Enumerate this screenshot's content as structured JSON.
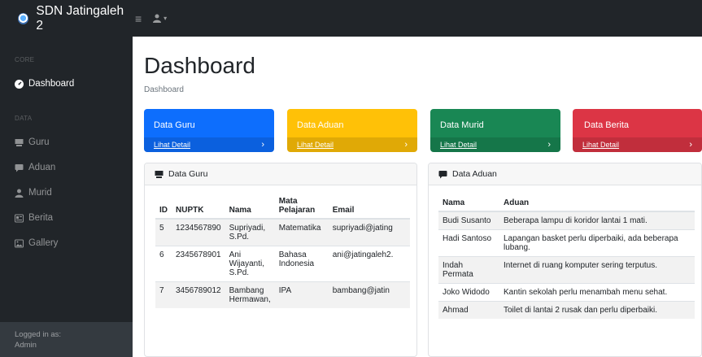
{
  "app": {
    "name": "SDN Jatingaleh 2"
  },
  "nav": {
    "toggle_icon": "≡",
    "user_icon": "♙"
  },
  "sidebar": {
    "core_heading": "CORE",
    "data_heading": "DATA",
    "items": [
      {
        "label": "Dashboard",
        "icon": "tachometer-icon"
      },
      {
        "label": "Guru",
        "icon": "chalkboard-teacher-icon"
      },
      {
        "label": "Aduan",
        "icon": "comment-icon"
      },
      {
        "label": "Murid",
        "icon": "user-icon"
      },
      {
        "label": "Berita",
        "icon": "newspaper-icon"
      },
      {
        "label": "Gallery",
        "icon": "image-icon"
      }
    ],
    "footer": {
      "line1": "Logged in as:",
      "line2": "Admin"
    }
  },
  "page": {
    "title": "Dashboard",
    "breadcrumb": "Dashboard"
  },
  "stat_cards": [
    {
      "title": "Data Guru",
      "link": "Lihat Detail",
      "color": "#0d6efd"
    },
    {
      "title": "Data Aduan",
      "link": "Lihat Detail",
      "color": "#ffc107"
    },
    {
      "title": "Data Murid",
      "link": "Lihat Detail",
      "color": "#198754"
    },
    {
      "title": "Data Berita",
      "link": "Lihat Detail",
      "color": "#dc3545"
    }
  ],
  "guru_panel": {
    "title": "Data Guru",
    "columns": [
      "ID",
      "NUPTK",
      "Nama",
      "Mata Pelajaran",
      "Email"
    ],
    "rows": [
      {
        "id": "5",
        "nuptk": "1234567890",
        "nama": "Supriyadi, S.Pd.",
        "mapel": "Matematika",
        "email": "supriyadi@jating"
      },
      {
        "id": "6",
        "nuptk": "2345678901",
        "nama": "Ani Wijayanti, S.Pd.",
        "mapel": "Bahasa Indonesia",
        "email": "ani@jatingaleh2."
      },
      {
        "id": "7",
        "nuptk": "3456789012",
        "nama": "Bambang Hermawan,",
        "mapel": "IPA",
        "email": "bambang@jatin"
      }
    ]
  },
  "aduan_panel": {
    "title": "Data Aduan",
    "columns": [
      "Nama",
      "Aduan"
    ],
    "rows": [
      {
        "nama": "Budi Susanto",
        "aduan": "Beberapa lampu di koridor lantai 1 mati."
      },
      {
        "nama": "Hadi Santoso",
        "aduan": "Lapangan basket perlu diperbaiki, ada beberapa lubang."
      },
      {
        "nama": "Indah Permata",
        "aduan": "Internet di ruang komputer sering terputus."
      },
      {
        "nama": "Joko Widodo",
        "aduan": "Kantin sekolah perlu menambah menu sehat."
      },
      {
        "nama": "Ahmad",
        "aduan": "Toilet di lantai 2 rusak dan perlu diperbaiki."
      }
    ]
  }
}
